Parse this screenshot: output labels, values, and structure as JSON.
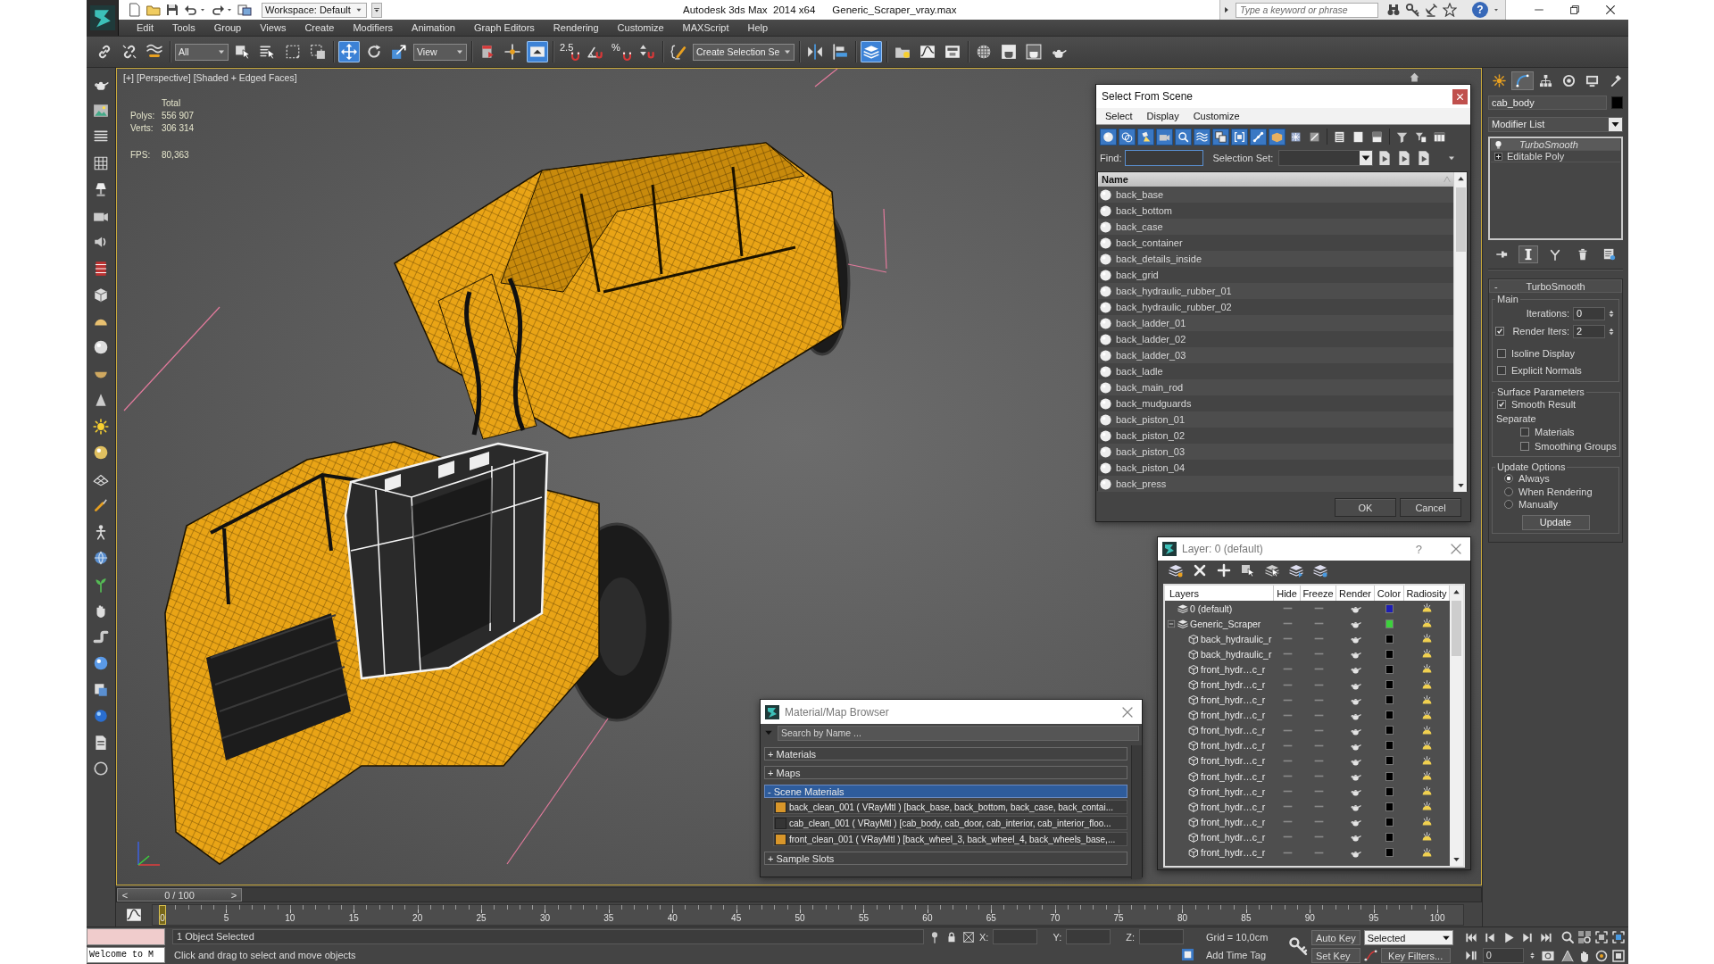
{
  "title_bar": {
    "workspace": "Workspace: Default",
    "app_title": "Autodesk 3ds Max  2014 x64",
    "file_name": "Generic_Scraper_vray.max",
    "search": {
      "placeholder": "Type a keyword or phrase"
    },
    "help": "?"
  },
  "menu": [
    "Edit",
    "Tools",
    "Group",
    "Views",
    "Create",
    "Modifiers",
    "Animation",
    "Graph Editors",
    "Rendering",
    "Customize",
    "MAXScript",
    "Help"
  ],
  "main_toolbar": [
    {
      "kind": "link",
      "selected": false
    },
    {
      "kind": "unlink",
      "selected": false
    },
    {
      "kind": "bind",
      "selected": false
    },
    {
      "kind": "dropdown",
      "value": "All"
    },
    {
      "kind": "select",
      "selected": false
    },
    {
      "kind": "select-name",
      "selected": false
    },
    {
      "kind": "region",
      "selected": false
    },
    {
      "kind": "crossing",
      "selected": false
    },
    {
      "kind": "move",
      "selected": true
    },
    {
      "kind": "rotate",
      "selected": false
    },
    {
      "kind": "scale",
      "selected": false
    },
    {
      "kind": "dropdown",
      "value": "View"
    },
    {
      "kind": "pivot",
      "selected": false
    },
    {
      "kind": "manipulate",
      "selected": false
    },
    {
      "kind": "shortcut",
      "selected": true
    },
    {
      "kind": "snap",
      "text": "2.5",
      "selected": false
    },
    {
      "kind": "angle-snap",
      "selected": false
    },
    {
      "kind": "percent-snap",
      "text": "%",
      "selected": false
    },
    {
      "kind": "spinner-snap",
      "selected": false
    },
    {
      "kind": "named-selection",
      "selected": false
    },
    {
      "kind": "dropdown",
      "value": "Create Selection Se"
    },
    {
      "kind": "mirror",
      "selected": false
    },
    {
      "kind": "align",
      "selected": false
    },
    {
      "kind": "layer-explorer",
      "selected": true
    },
    {
      "kind": "ribbon",
      "selected": false
    },
    {
      "kind": "curve-editor",
      "selected": false
    },
    {
      "kind": "schematic",
      "selected": false
    },
    {
      "kind": "material-editor",
      "selected": false
    },
    {
      "kind": "render-setup",
      "selected": false
    },
    {
      "kind": "frame-window",
      "selected": false
    },
    {
      "kind": "render",
      "selected": false
    }
  ],
  "viewport": {
    "labels": [
      "[+]",
      "[Perspective]",
      "[Shaded + Edged Faces]"
    ],
    "stats": {
      "title": "Total",
      "rows": [
        {
          "label": "Polys:",
          "value": "556 907"
        },
        {
          "label": "Verts:",
          "value": "306 314"
        }
      ],
      "fps": {
        "label": "FPS:",
        "value": "80,363"
      }
    }
  },
  "command_panel": {
    "tabs": [
      {
        "kind": "create",
        "selected": false
      },
      {
        "kind": "modify",
        "selected": true
      },
      {
        "kind": "hierarchy",
        "selected": false
      },
      {
        "kind": "motion",
        "selected": false
      },
      {
        "kind": "display",
        "selected": false
      },
      {
        "kind": "utilities",
        "selected": false
      }
    ],
    "object_name": "cab_body",
    "modifier_list": "Modifier List",
    "stack": [
      {
        "label": "TurboSmooth",
        "kind": "modifier",
        "enabled": true,
        "selected": true
      },
      {
        "label": "Editable Poly",
        "kind": "base",
        "expanded": false,
        "selected": false
      }
    ],
    "stack_tools": [
      {
        "kind": "pin",
        "selected": false
      },
      {
        "kind": "show-result",
        "selected": true
      },
      {
        "kind": "make-unique",
        "selected": false
      },
      {
        "kind": "remove",
        "selected": false
      },
      {
        "kind": "configure",
        "selected": false
      }
    ],
    "rollout": {
      "toggle": "-",
      "title": "TurboSmooth",
      "groups": [
        {
          "label": "Main",
          "controls": [
            {
              "kind": "spinner",
              "label": "Iterations:",
              "value": "0"
            },
            {
              "kind": "spinner",
              "label": "Render Iters:",
              "value": "2",
              "checked": true
            },
            {
              "kind": "checkbox",
              "label": "Isoline Display",
              "checked": false
            },
            {
              "kind": "checkbox",
              "label": "Explicit Normals",
              "checked": false
            }
          ]
        },
        {
          "label": "Surface Parameters",
          "controls": [
            {
              "kind": "checkbox",
              "label": "Smooth Result",
              "checked": true
            },
            {
              "kind": "heading",
              "label": "Separate",
              "children": [
                {
                  "kind": "checkbox",
                  "label": "Materials",
                  "checked": false
                },
                {
                  "kind": "checkbox",
                  "label": "Smoothing Groups",
                  "checked": false
                }
              ]
            }
          ]
        },
        {
          "label": "Update Options",
          "controls": [
            {
              "kind": "radio",
              "label": "Always",
              "selected": true
            },
            {
              "kind": "radio",
              "label": "When Rendering",
              "selected": false
            },
            {
              "kind": "radio",
              "label": "Manually",
              "selected": false
            },
            {
              "kind": "button",
              "label": "Update"
            }
          ]
        }
      ]
    }
  },
  "select_from_scene": {
    "title": "Select From Scene",
    "menu": [
      "Select",
      "Display",
      "Customize"
    ],
    "toolbar": [
      {
        "kind": "geometry",
        "selected": true
      },
      {
        "kind": "shape",
        "selected": true
      },
      {
        "kind": "light",
        "selected": true
      },
      {
        "kind": "camera",
        "selected": true
      },
      {
        "kind": "helper",
        "selected": true
      },
      {
        "kind": "space-warp",
        "selected": true
      },
      {
        "kind": "group",
        "selected": true
      },
      {
        "kind": "xref",
        "selected": true
      },
      {
        "kind": "bone",
        "selected": true
      },
      {
        "kind": "container",
        "selected": true
      },
      {
        "kind": "frozen",
        "selected": false
      },
      {
        "kind": "hidden",
        "selected": false
      },
      {
        "kind": "select-all",
        "selected": false
      },
      {
        "kind": "select-none",
        "selected": false
      },
      {
        "kind": "select-invert",
        "selected": false
      },
      {
        "kind": "filter",
        "selected": false
      },
      {
        "kind": "filter-list",
        "selected": false
      },
      {
        "kind": "columns",
        "selected": false
      }
    ],
    "find_label": "Find:",
    "selection_set_label": "Selection Set:",
    "column": "Name",
    "rows": [
      {
        "name": "back_base",
        "selected": false
      },
      {
        "name": "back_bottom",
        "selected": false
      },
      {
        "name": "back_case",
        "selected": false
      },
      {
        "name": "back_container",
        "selected": false
      },
      {
        "name": "back_details_inside",
        "selected": false
      },
      {
        "name": "back_grid",
        "selected": false
      },
      {
        "name": "back_hydraulic_rubber_01",
        "selected": false
      },
      {
        "name": "back_hydraulic_rubber_02",
        "selected": false
      },
      {
        "name": "back_ladder_01",
        "selected": false
      },
      {
        "name": "back_ladder_02",
        "selected": false
      },
      {
        "name": "back_ladder_03",
        "selected": false
      },
      {
        "name": "back_ladle",
        "selected": false
      },
      {
        "name": "back_main_rod",
        "selected": false
      },
      {
        "name": "back_mudguards",
        "selected": false
      },
      {
        "name": "back_piston_01",
        "selected": false
      },
      {
        "name": "back_piston_02",
        "selected": false
      },
      {
        "name": "back_piston_03",
        "selected": false
      },
      {
        "name": "back_piston_04",
        "selected": false
      },
      {
        "name": "back_press",
        "selected": false
      }
    ],
    "buttons": [
      "OK",
      "Cancel"
    ]
  },
  "layer_dialog": {
    "title": "Layer: 0 (default)",
    "help": "?",
    "columns": [
      "Layers",
      "Hide",
      "Freeze",
      "Render",
      "Color",
      "Radiosity"
    ],
    "layers": [
      {
        "name": "0 (default)",
        "kind": "layer",
        "hidden": false,
        "frozen": false,
        "color": "#1e1eb4"
      },
      {
        "name": "Generic_Scraper",
        "kind": "layer",
        "expanded": true,
        "hidden": false,
        "frozen": false,
        "color": "#3cd23c",
        "children": [
          {
            "name": "back_hydraulic_r",
            "kind": "object",
            "hidden": false,
            "frozen": false,
            "color": "#000000"
          },
          {
            "name": "back_hydraulic_r",
            "kind": "object",
            "hidden": false,
            "frozen": false,
            "color": "#000000"
          },
          {
            "name": "front_hydr…c_r",
            "kind": "object",
            "hidden": false,
            "frozen": false,
            "color": "#000000"
          },
          {
            "name": "front_hydr…c_r",
            "kind": "object",
            "hidden": false,
            "frozen": false,
            "color": "#000000"
          },
          {
            "name": "front_hydr…c_r",
            "kind": "object",
            "hidden": false,
            "frozen": false,
            "color": "#000000"
          },
          {
            "name": "front_hydr…c_r",
            "kind": "object",
            "hidden": false,
            "frozen": false,
            "color": "#000000"
          },
          {
            "name": "front_hydr…c_r",
            "kind": "object",
            "hidden": false,
            "frozen": false,
            "color": "#000000"
          },
          {
            "name": "front_hydr…c_r",
            "kind": "object",
            "hidden": false,
            "frozen": false,
            "color": "#000000"
          },
          {
            "name": "front_hydr…c_r",
            "kind": "object",
            "hidden": false,
            "frozen": false,
            "color": "#000000"
          },
          {
            "name": "front_hydr…c_r",
            "kind": "object",
            "hidden": false,
            "frozen": false,
            "color": "#000000"
          },
          {
            "name": "front_hydr…c_r",
            "kind": "object",
            "hidden": false,
            "frozen": false,
            "color": "#000000"
          },
          {
            "name": "front_hydr…c_r",
            "kind": "object",
            "hidden": false,
            "frozen": false,
            "color": "#000000"
          },
          {
            "name": "front_hydr…c_r",
            "kind": "object",
            "hidden": false,
            "frozen": false,
            "color": "#000000"
          },
          {
            "name": "front_hydr…c_r",
            "kind": "object",
            "hidden": false,
            "frozen": false,
            "color": "#000000"
          },
          {
            "name": "front_hydr…c_r",
            "kind": "object",
            "hidden": false,
            "frozen": false,
            "color": "#000000"
          }
        ]
      }
    ]
  },
  "material_browser": {
    "title": "Material/Map Browser",
    "search": {
      "placeholder": "Search by Name ..."
    },
    "sections": [
      {
        "label": "+ Materials",
        "selected": false
      },
      {
        "label": "+ Maps",
        "selected": false
      },
      {
        "label": "- Scene Materials",
        "selected": true,
        "items": [
          {
            "label": "back_clean_001 ( VRayMtl ) [back_base, back_bottom, back_case, back_contai...",
            "color": "#d8962a"
          },
          {
            "label": "cab_clean_001 ( VRayMtl ) [cab_body, cab_door, cab_interior, cab_interior_floo...",
            "color": "#353535"
          },
          {
            "label": "front_clean_001 ( VRayMtl ) [back_wheel_3, back_wheel_4, back_wheels_base,...",
            "color": "#d8962a"
          }
        ]
      },
      {
        "label": "+ Sample Slots",
        "selected": false
      }
    ]
  },
  "timeline": {
    "slider": {
      "prev": "<",
      "label": "0 / 100",
      "next": ">",
      "level": 0
    },
    "ticks": [
      "0",
      "5",
      "10",
      "15",
      "20",
      "25",
      "30",
      "35",
      "40",
      "45",
      "50",
      "55",
      "60",
      "65",
      "70",
      "75",
      "80",
      "85",
      "90",
      "95",
      "100"
    ]
  },
  "status_bar": {
    "listener": "Welcome to M",
    "selection": "1 Object Selected",
    "prompt": "Click and drag to select and move objects",
    "coords": [
      "X:",
      "Y:",
      "Z:"
    ],
    "grid": "Grid = 10,0cm",
    "time_tag": "Add Time Tag",
    "auto_key": "Auto Key",
    "key_mode": "Selected",
    "set_key": "Set Key",
    "key_filters": "Key Filters...",
    "frame": "0"
  }
}
